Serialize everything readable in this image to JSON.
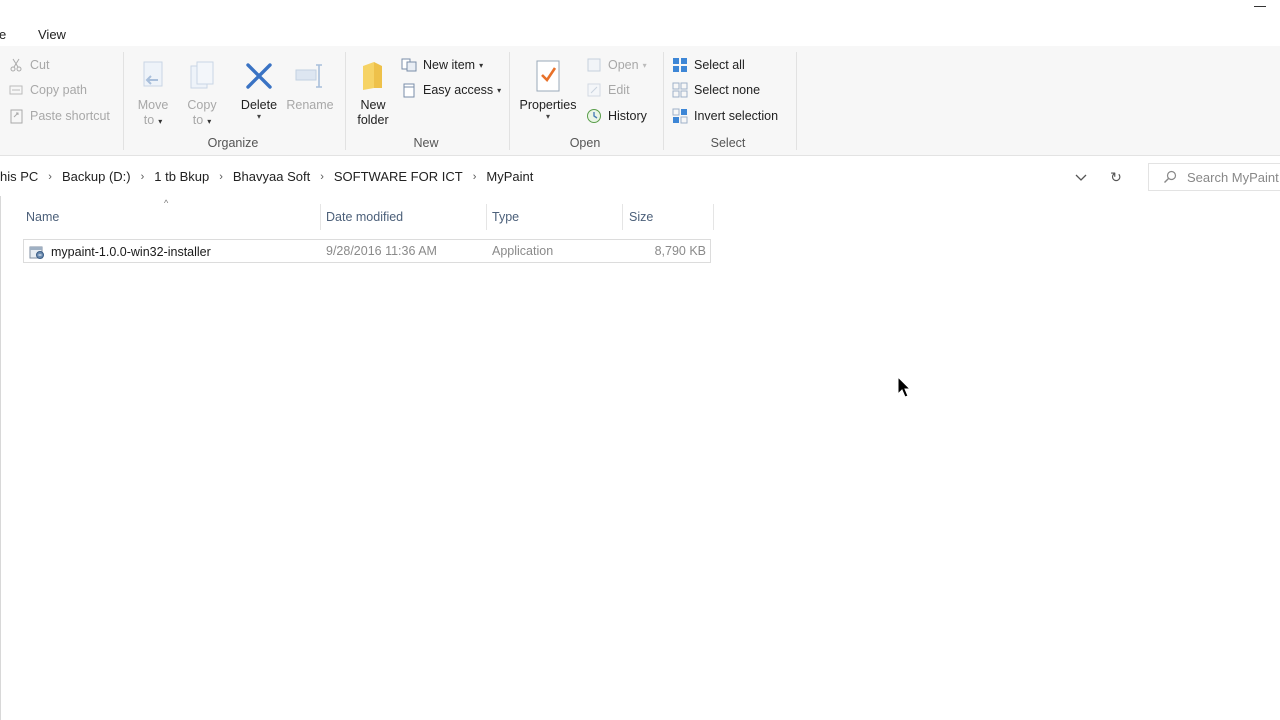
{
  "tabs": {
    "file_partial": "e",
    "view": "View"
  },
  "ribbon": {
    "clipboard": {
      "cut": "Cut",
      "copy_path": "Copy path",
      "paste_shortcut": "Paste shortcut"
    },
    "organize": {
      "move_to_line1": "Move",
      "move_to_line2": "to",
      "copy_to_line1": "Copy",
      "copy_to_line2": "to",
      "delete": "Delete",
      "rename": "Rename",
      "label": "Organize"
    },
    "new": {
      "new_folder_line1": "New",
      "new_folder_line2": "folder",
      "new_item": "New item",
      "easy_access": "Easy access",
      "label": "New"
    },
    "open": {
      "properties": "Properties",
      "open": "Open",
      "edit": "Edit",
      "history": "History",
      "label": "Open"
    },
    "select": {
      "select_all": "Select all",
      "select_none": "Select none",
      "invert_selection": "Invert selection",
      "label": "Select"
    }
  },
  "address": {
    "crumbs": [
      "his PC",
      "Backup (D:)",
      "1 tb Bkup",
      "Bhavyaa Soft",
      "SOFTWARE FOR ICT",
      "MyPaint"
    ],
    "search_placeholder": "Search MyPaint"
  },
  "columns": {
    "name": "Name",
    "date_modified": "Date modified",
    "type": "Type",
    "size": "Size"
  },
  "files": [
    {
      "name": "mypaint-1.0.0-win32-installer",
      "date_modified": "9/28/2016 11:36 AM",
      "type": "Application",
      "size": "8,790 KB"
    }
  ],
  "colors": {
    "accent": "#2b79d0",
    "delete_x": "#2e6fc0",
    "folder": "#f2c94c",
    "header_text": "#4c607a"
  }
}
